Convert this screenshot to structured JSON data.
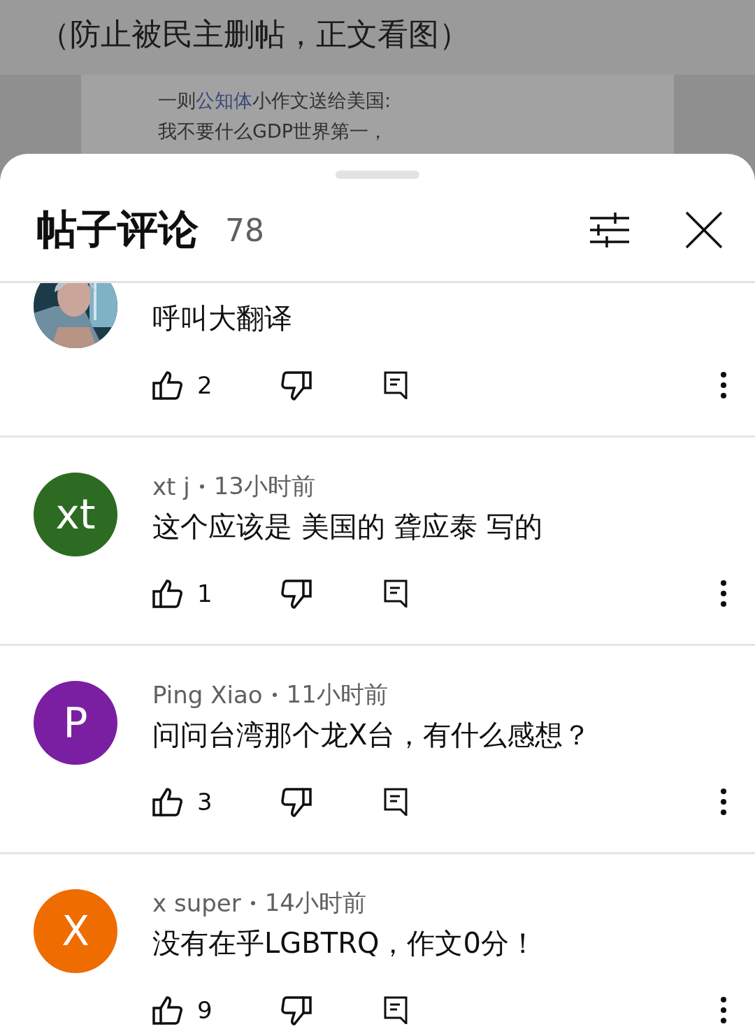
{
  "post": {
    "caption": "（防止被民主删帖，正文看图）",
    "image_lines": [
      {
        "before": "一则",
        "link": "公知体",
        "after": "小作文送给美国:"
      },
      {
        "before": "我不要什么GDP世界第一，"
      }
    ]
  },
  "sheet": {
    "title": "帖子评论",
    "count": "78"
  },
  "comments": [
    {
      "body": "呼叫大翻译",
      "likes": "2"
    },
    {
      "avatar": {
        "kind": "letter",
        "letter": "xt",
        "color": "#2e6b22"
      },
      "author": "xt j",
      "time": "13小时前",
      "body": "这个应该是 美国的 聋应泰 写的",
      "likes": "1"
    },
    {
      "avatar": {
        "kind": "letter",
        "letter": "P",
        "color": "#7b1fa2"
      },
      "author": "Ping Xiao",
      "time": "11小时前",
      "body": "问问台湾那个龙X台，有什么感想？",
      "likes": "3"
    },
    {
      "avatar": {
        "kind": "letter",
        "letter": "X",
        "color": "#ef6c00"
      },
      "author": "x super",
      "time": "14小时前",
      "body": "没有在乎LGBTRQ，作文0分！",
      "likes": "9"
    }
  ]
}
